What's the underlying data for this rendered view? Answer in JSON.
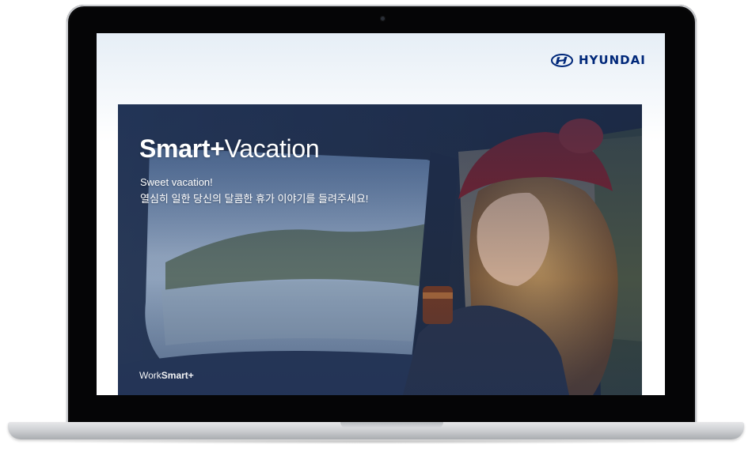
{
  "brand": {
    "logo_text": "HYUNDAI",
    "logo_icon": "hyundai-emblem-icon",
    "color": "#00287a"
  },
  "hero": {
    "title_bold": "Smart+",
    "title_light": "Vacation",
    "subtitle_line1": "Sweet vacation!",
    "subtitle_line2": "열심히 일한 당신의 달콤한 휴가 이야기를 들려주세요!",
    "footer_regular": "Work",
    "footer_bold": "Smart+"
  },
  "device": {
    "type": "laptop",
    "camera_icon": "webcam-icon"
  }
}
